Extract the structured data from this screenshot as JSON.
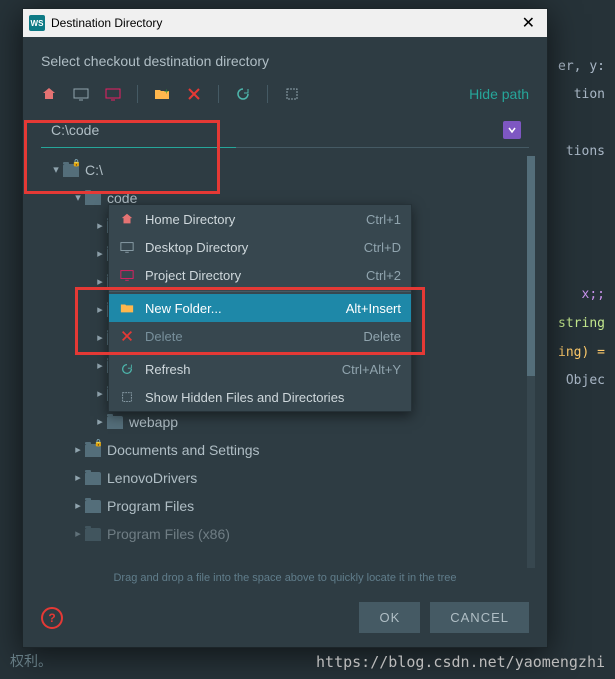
{
  "backdrop": {
    "frag1": "er, y:",
    "frag2": "tion",
    "frag3": "tions",
    "frag4": "x;;",
    "frag5": "string",
    "frag6": "ing) =",
    "frag7": "Objec"
  },
  "titlebar": {
    "title": "Destination Directory"
  },
  "subtitle": "Select checkout destination directory",
  "toolbar": {
    "hide_path": "Hide path"
  },
  "path_value": "C:\\code",
  "tree": {
    "root": "C:\\",
    "node_code": "code",
    "items_l2": [
      "webapp"
    ],
    "items_l1": [
      "Documents and Settings",
      "LenovoDrivers",
      "Program Files",
      "Program Files (x86)"
    ]
  },
  "context_menu": {
    "items": [
      {
        "icon": "home-icon",
        "label": "Home Directory",
        "shortcut": "Ctrl+1"
      },
      {
        "icon": "desktop-icon",
        "label": "Desktop Directory",
        "shortcut": "Ctrl+D"
      },
      {
        "icon": "project-icon",
        "label": "Project Directory",
        "shortcut": "Ctrl+2"
      },
      {
        "icon": "new-folder-icon",
        "label": "New Folder...",
        "shortcut": "Alt+Insert",
        "highlight": true
      },
      {
        "icon": "delete-icon",
        "label": "Delete",
        "shortcut": "Delete",
        "disabled": true
      },
      {
        "icon": "refresh-icon",
        "label": "Refresh",
        "shortcut": "Ctrl+Alt+Y"
      },
      {
        "icon": "show-hidden-icon",
        "label": "Show Hidden Files and Directories",
        "shortcut": ""
      }
    ]
  },
  "hint": "Drag and drop a file into the space above to quickly locate it in the tree",
  "buttons": {
    "ok": "OK",
    "cancel": "CANCEL"
  },
  "footer": {
    "left": "权利。",
    "url": "https://blog.csdn.net/yaomengzhi"
  }
}
